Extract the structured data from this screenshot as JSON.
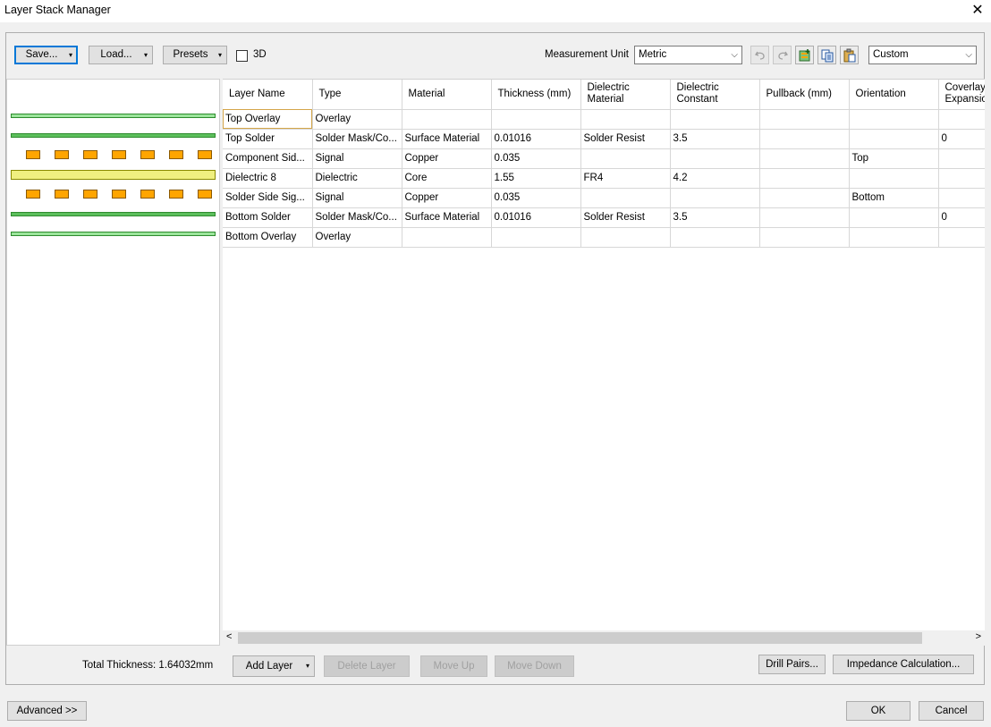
{
  "window": {
    "title": "Layer Stack Manager",
    "close_glyph": "✕"
  },
  "toolbar": {
    "save_label": "Save...",
    "load_label": "Load...",
    "presets_label": "Presets",
    "dropdown_glyph": "▾",
    "checkbox_3d_label": "3D",
    "checkbox_3d_checked": false,
    "measurement_unit_label": "Measurement Unit",
    "measurement_unit_value": "Metric",
    "preset_combo_value": "Custom",
    "combo_arrow": "⌵",
    "undo_icon": "undo-icon",
    "redo_icon": "redo-icon"
  },
  "table": {
    "columns": [
      "Layer Name",
      "Type",
      "Material",
      "Thickness (mm)",
      "Dielectric Material",
      "Dielectric Constant",
      "Pullback (mm)",
      "Orientation",
      "Coverlay Expansion"
    ],
    "rows": [
      [
        "Top Overlay",
        "Overlay",
        "",
        "",
        "",
        "",
        "",
        "",
        ""
      ],
      [
        "Top Solder",
        "Solder Mask/Co...",
        "Surface Material",
        "0.01016",
        "Solder Resist",
        "3.5",
        "",
        "",
        "0"
      ],
      [
        "Component Sid...",
        "Signal",
        "Copper",
        "0.035",
        "",
        "",
        "",
        "Top",
        ""
      ],
      [
        "Dielectric 8",
        "Dielectric",
        "Core",
        "1.55",
        "FR4",
        "4.2",
        "",
        "",
        ""
      ],
      [
        "Solder Side Sig...",
        "Signal",
        "Copper",
        "0.035",
        "",
        "",
        "",
        "Bottom",
        ""
      ],
      [
        "Bottom Solder",
        "Solder Mask/Co...",
        "Surface Material",
        "0.01016",
        "Solder Resist",
        "3.5",
        "",
        "",
        "0"
      ],
      [
        "Bottom Overlay",
        "Overlay",
        "",
        "",
        "",
        "",
        "",
        "",
        ""
      ]
    ]
  },
  "scroll": {
    "left": "<",
    "right": ">"
  },
  "footer": {
    "total_thickness": "Total Thickness: 1.64032mm",
    "add_layer_label": "Add Layer",
    "delete_layer_label": "Delete Layer",
    "move_up_label": "Move Up",
    "move_down_label": "Move Down",
    "drill_pairs_label": "Drill Pairs...",
    "impedance_label": "Impedance Calculation..."
  },
  "bottom": {
    "advanced_label": "Advanced >>",
    "ok_label": "OK",
    "cancel_label": "Cancel"
  },
  "colors": {
    "copper": "#ffa500",
    "solder": "#9be59b",
    "dielectric": "#f0f080",
    "focus": "#0078d7"
  }
}
